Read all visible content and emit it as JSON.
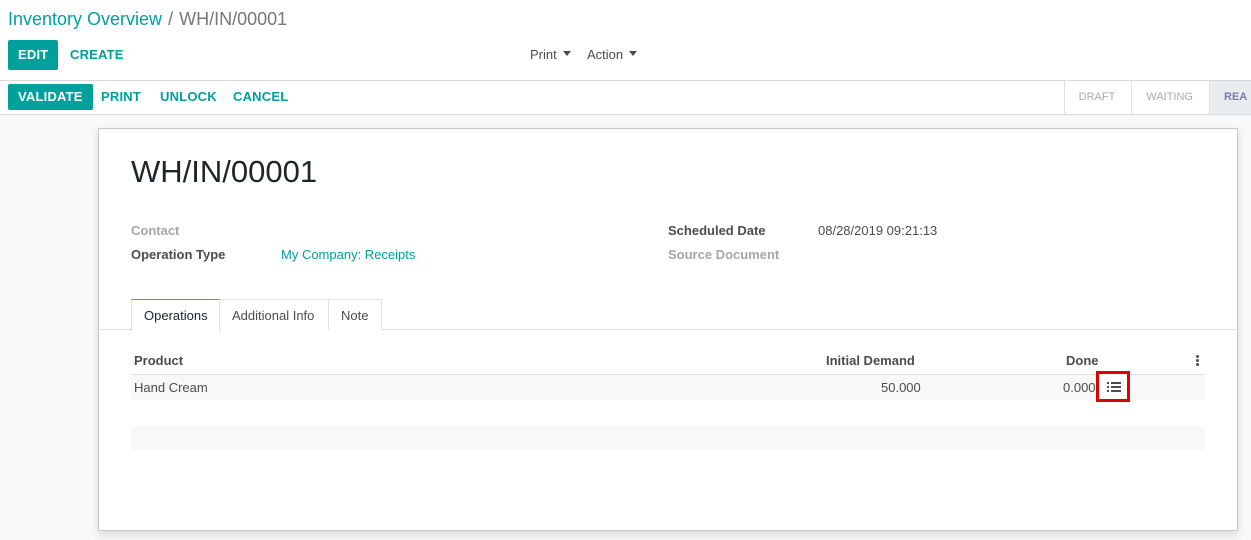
{
  "breadcrumb": {
    "parent": "Inventory Overview",
    "separator": "/",
    "current": "WH/IN/00001"
  },
  "toolbar": {
    "edit_label": "EDIT",
    "create_label": "CREATE",
    "print_label": "Print",
    "action_label": "Action"
  },
  "header_buttons": {
    "validate": "VALIDATE",
    "print": "PRINT",
    "unlock": "UNLOCK",
    "cancel": "CANCEL"
  },
  "statusbar": {
    "stages": [
      "DRAFT",
      "WAITING",
      "REA"
    ],
    "active_index": 2
  },
  "record": {
    "name": "WH/IN/00001",
    "fields": {
      "contact_label": "Contact",
      "contact_value": "",
      "operation_type_label": "Operation Type",
      "operation_type_value": "My Company: Receipts",
      "scheduled_date_label": "Scheduled Date",
      "scheduled_date_value": "08/28/2019 09:21:13",
      "source_document_label": "Source Document",
      "source_document_value": ""
    }
  },
  "tabs": [
    "Operations",
    "Additional Info",
    "Note"
  ],
  "operations_table": {
    "columns": {
      "product": "Product",
      "initial_demand": "Initial Demand",
      "done": "Done"
    },
    "rows": [
      {
        "product": "Hand Cream",
        "initial_demand": "50.000",
        "done": "0.000"
      }
    ]
  },
  "icons": {
    "detail_button": "list-icon",
    "column_options": "kebab-icon",
    "dropdown": "caret-down-icon"
  },
  "colors": {
    "brand": "#00a09d",
    "highlight_border": "#e00000",
    "active_tab_accent": "#7c7bad"
  }
}
